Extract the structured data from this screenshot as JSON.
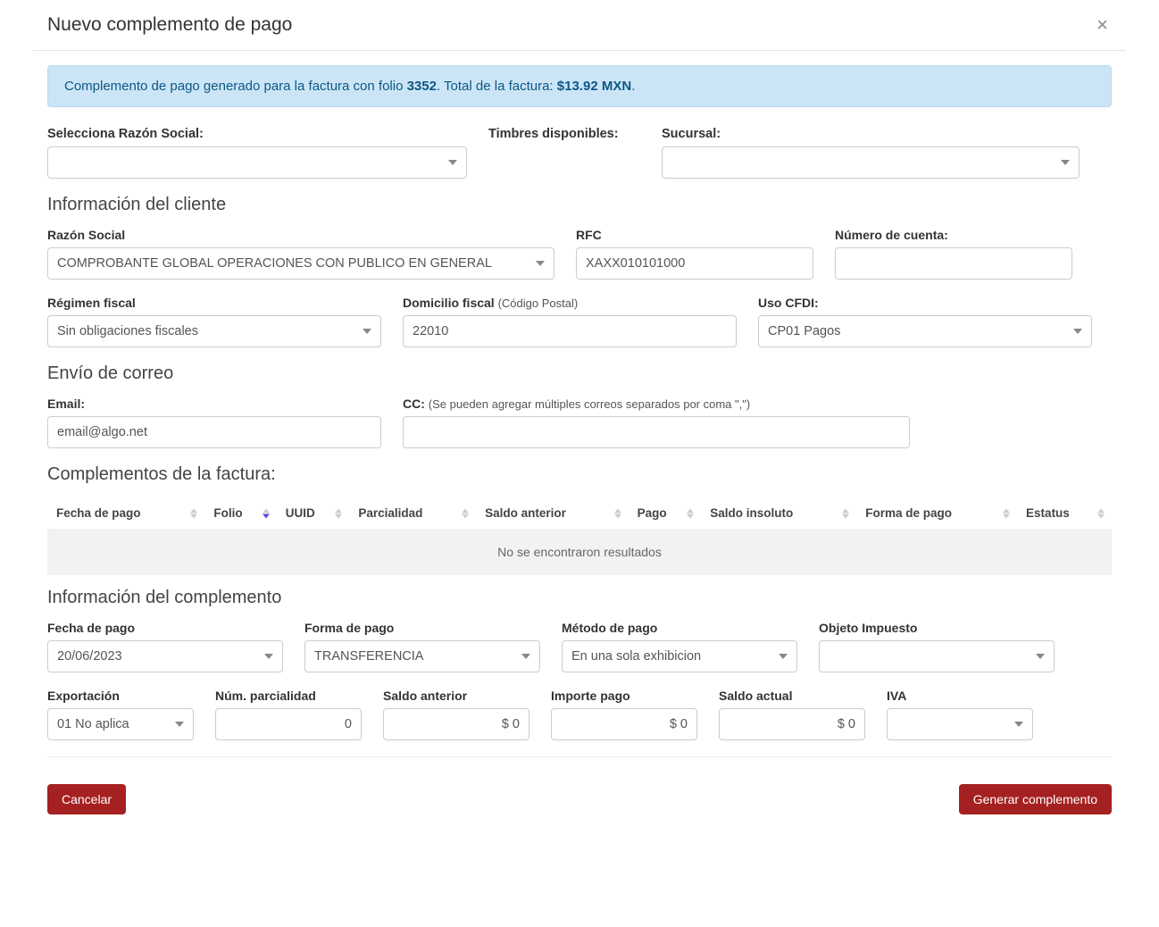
{
  "modal": {
    "title": "Nuevo complemento de pago",
    "close_label": "×"
  },
  "alert": {
    "prefix": "Complemento de pago generado para la factura con folio ",
    "folio": "3352",
    "middle": ". Total de la factura: ",
    "total": "$13.92 MXN",
    "suffix": "."
  },
  "top": {
    "razon_social_label": "Selecciona Razón Social:",
    "razon_social_value": "",
    "timbres_label": "Timbres disponibles:",
    "timbres_value": "",
    "sucursal_label": "Sucursal:",
    "sucursal_value": ""
  },
  "cliente": {
    "heading": "Información del cliente",
    "razon_social_label": "Razón Social",
    "razon_social_value": "COMPROBANTE GLOBAL OPERACIONES CON PUBLICO EN GENERAL",
    "rfc_label": "RFC",
    "rfc_value": "XAXX010101000",
    "num_cuenta_label": "Número de cuenta:",
    "num_cuenta_value": "",
    "regimen_label": "Régimen fiscal",
    "regimen_value": "Sin obligaciones fiscales",
    "domicilio_label": "Domicilio fiscal",
    "domicilio_hint": "(Código Postal)",
    "domicilio_value": "22010",
    "uso_cfdi_label": "Uso CFDI:",
    "uso_cfdi_value": "CP01 Pagos"
  },
  "correo": {
    "heading": "Envío de correo",
    "email_label": "Email:",
    "email_value": "email@algo.net",
    "cc_label": "CC:",
    "cc_hint": "(Se pueden agregar múltiples correos separados por coma \",\")",
    "cc_value": ""
  },
  "tabla": {
    "heading": "Complementos de la factura:",
    "columns": [
      "Fecha de pago",
      "Folio",
      "UUID",
      "Parcialidad",
      "Saldo anterior",
      "Pago",
      "Saldo insoluto",
      "Forma de pago",
      "Estatus"
    ],
    "sorted_desc_index": 1,
    "empty_text": "No se encontraron resultados"
  },
  "complemento": {
    "heading": "Información del complemento",
    "fecha_label": "Fecha de pago",
    "fecha_value": "20/06/2023",
    "forma_label": "Forma de pago",
    "forma_value": "TRANSFERENCIA",
    "metodo_label": "Método de pago",
    "metodo_value": "En una sola exhibicion",
    "objeto_label": "Objeto Impuesto",
    "objeto_value": "",
    "export_label": "Exportación",
    "export_value": "01 No aplica",
    "numparc_label": "Núm. parcialidad",
    "numparc_value": "0",
    "saldoant_label": "Saldo anterior",
    "saldoant_value": "$ 0",
    "importe_label": "Importe pago",
    "importe_value": "$ 0",
    "saldoact_label": "Saldo actual",
    "saldoact_value": "$ 0",
    "iva_label": "IVA",
    "iva_value": ""
  },
  "footer": {
    "cancel": "Cancelar",
    "generate": "Generar complemento"
  }
}
